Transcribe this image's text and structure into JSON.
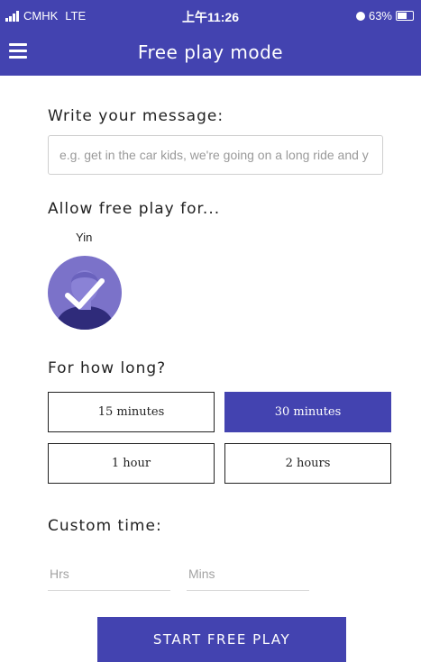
{
  "status_bar": {
    "carrier": "CMHK",
    "network": "LTE",
    "time": "上午11:26",
    "battery": "63%",
    "battery_level": 0.63,
    "icons": [
      "signal-icon",
      "alarm-icon",
      "battery-icon"
    ]
  },
  "header": {
    "title": "Free play mode",
    "menu_icon": "hamburger-menu-icon"
  },
  "message": {
    "heading": "Write your message:",
    "placeholder": "e.g. get in the car kids, we're going on a long ride and y",
    "value": ""
  },
  "allow": {
    "heading": "Allow free play for...",
    "children": [
      {
        "name": "Yin",
        "selected": true,
        "avatar_icon": "child-avatar-icon",
        "check_icon": "checkmark-icon"
      }
    ]
  },
  "duration": {
    "heading": "For how long?",
    "options": [
      {
        "label": "15 minutes",
        "selected": false
      },
      {
        "label": "30 minutes",
        "selected": true
      },
      {
        "label": "1 hour",
        "selected": false
      },
      {
        "label": "2 hours",
        "selected": false
      }
    ]
  },
  "custom": {
    "heading": "Custom time:",
    "hours_placeholder": "Hrs",
    "minutes_placeholder": "Mins"
  },
  "start_button": {
    "label": "START FREE PLAY"
  },
  "colors": {
    "accent": "#4343b0",
    "avatar_bg": "#7b72c9"
  }
}
